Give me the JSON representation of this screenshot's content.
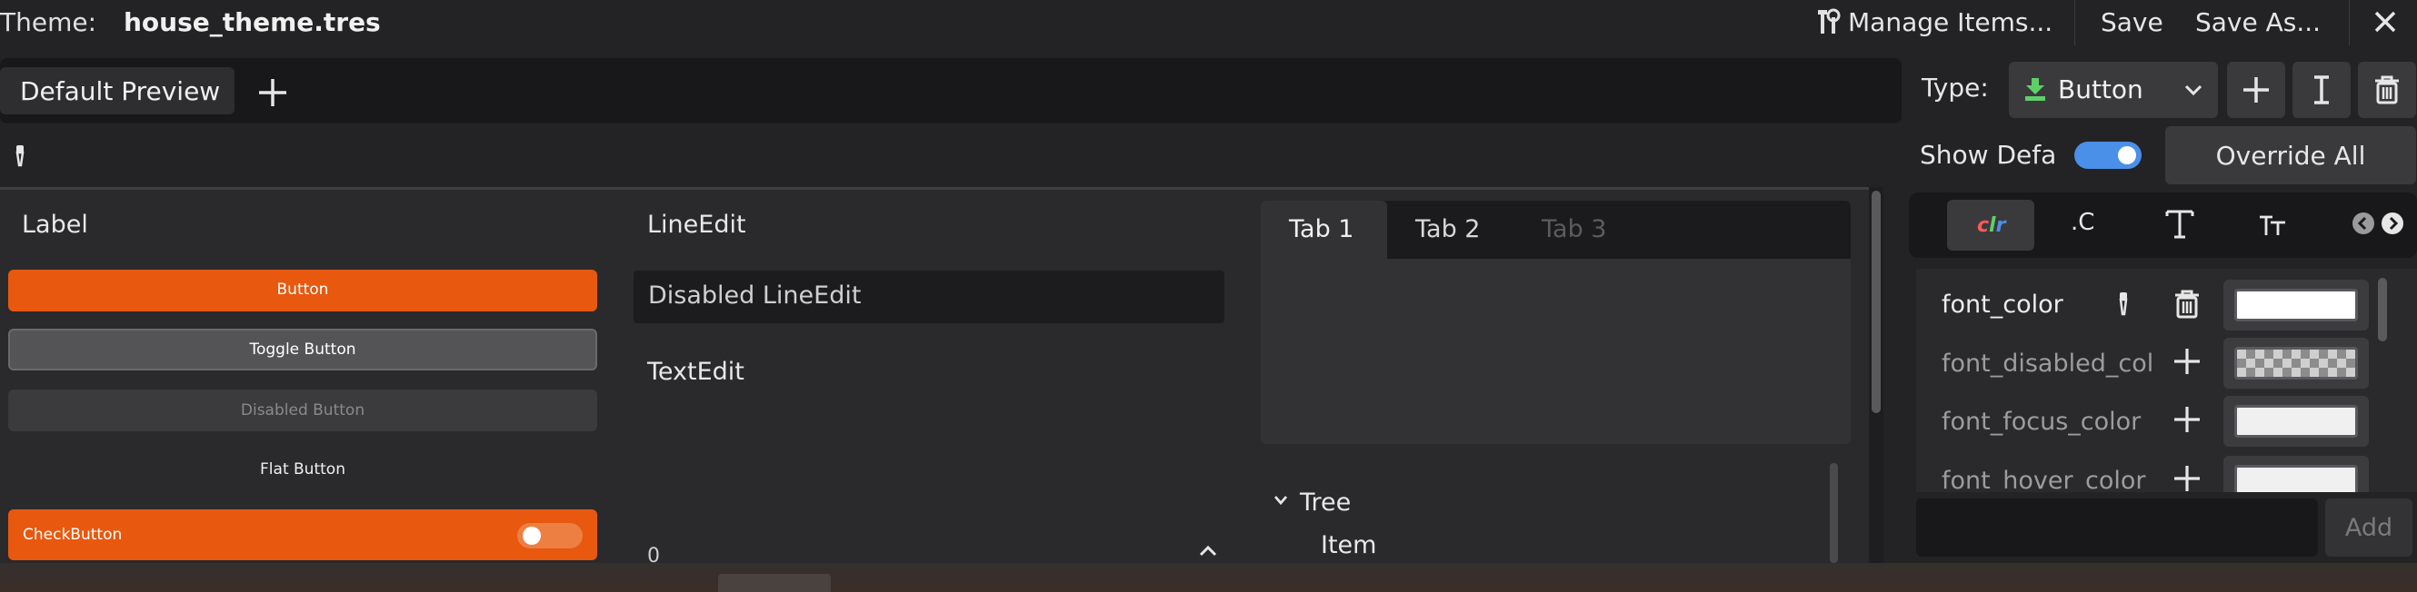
{
  "header": {
    "theme_label": "Theme:",
    "theme_file": "house_theme.tres",
    "manage_items": "Manage Items...",
    "save": "Save",
    "save_as": "Save As...",
    "close_glyph": "✕",
    "manage_icon": "tools-icon",
    "close_icon": "close-icon"
  },
  "preview_tabs": {
    "active_tab": "Default Preview",
    "add_glyph": "+"
  },
  "picker_icon": "eyedropper-icon",
  "preview": {
    "label": "Label",
    "button": "Button",
    "toggle_button": "Toggle Button",
    "disabled_button": "Disabled Button",
    "flat_button": "Flat Button",
    "check_button": "CheckButton",
    "line_edit": "LineEdit",
    "disabled_line_edit": "Disabled LineEdit",
    "text_edit": "TextEdit",
    "tabs": [
      "Tab 1",
      "Tab 2",
      "Tab 3"
    ],
    "tree_root": "Tree",
    "tree_item": "Item",
    "partial_char": "0"
  },
  "colors": {
    "accent": "#e8580e",
    "toggle_on": "#4a8fe8",
    "type_icon": "#5fd068"
  },
  "type_panel": {
    "type_label": "Type:",
    "type_value": "Button",
    "show_default": "Show Defa",
    "override_all": "Override All",
    "add_button": "Add",
    "category_tabs": [
      {
        "icon": "color-icon",
        "label": "clr"
      },
      {
        "icon": "constant-icon",
        "label": ".C"
      },
      {
        "icon": "font-icon",
        "label": "T"
      },
      {
        "icon": "font-size-icon",
        "label": "tT"
      }
    ],
    "items": [
      {
        "name": "font_color",
        "action": "edit"
      },
      {
        "name": "font_disabled_col",
        "action": "add"
      },
      {
        "name": "font_focus_color",
        "action": "add"
      },
      {
        "name": "font_hover_color",
        "action": "add"
      }
    ]
  }
}
